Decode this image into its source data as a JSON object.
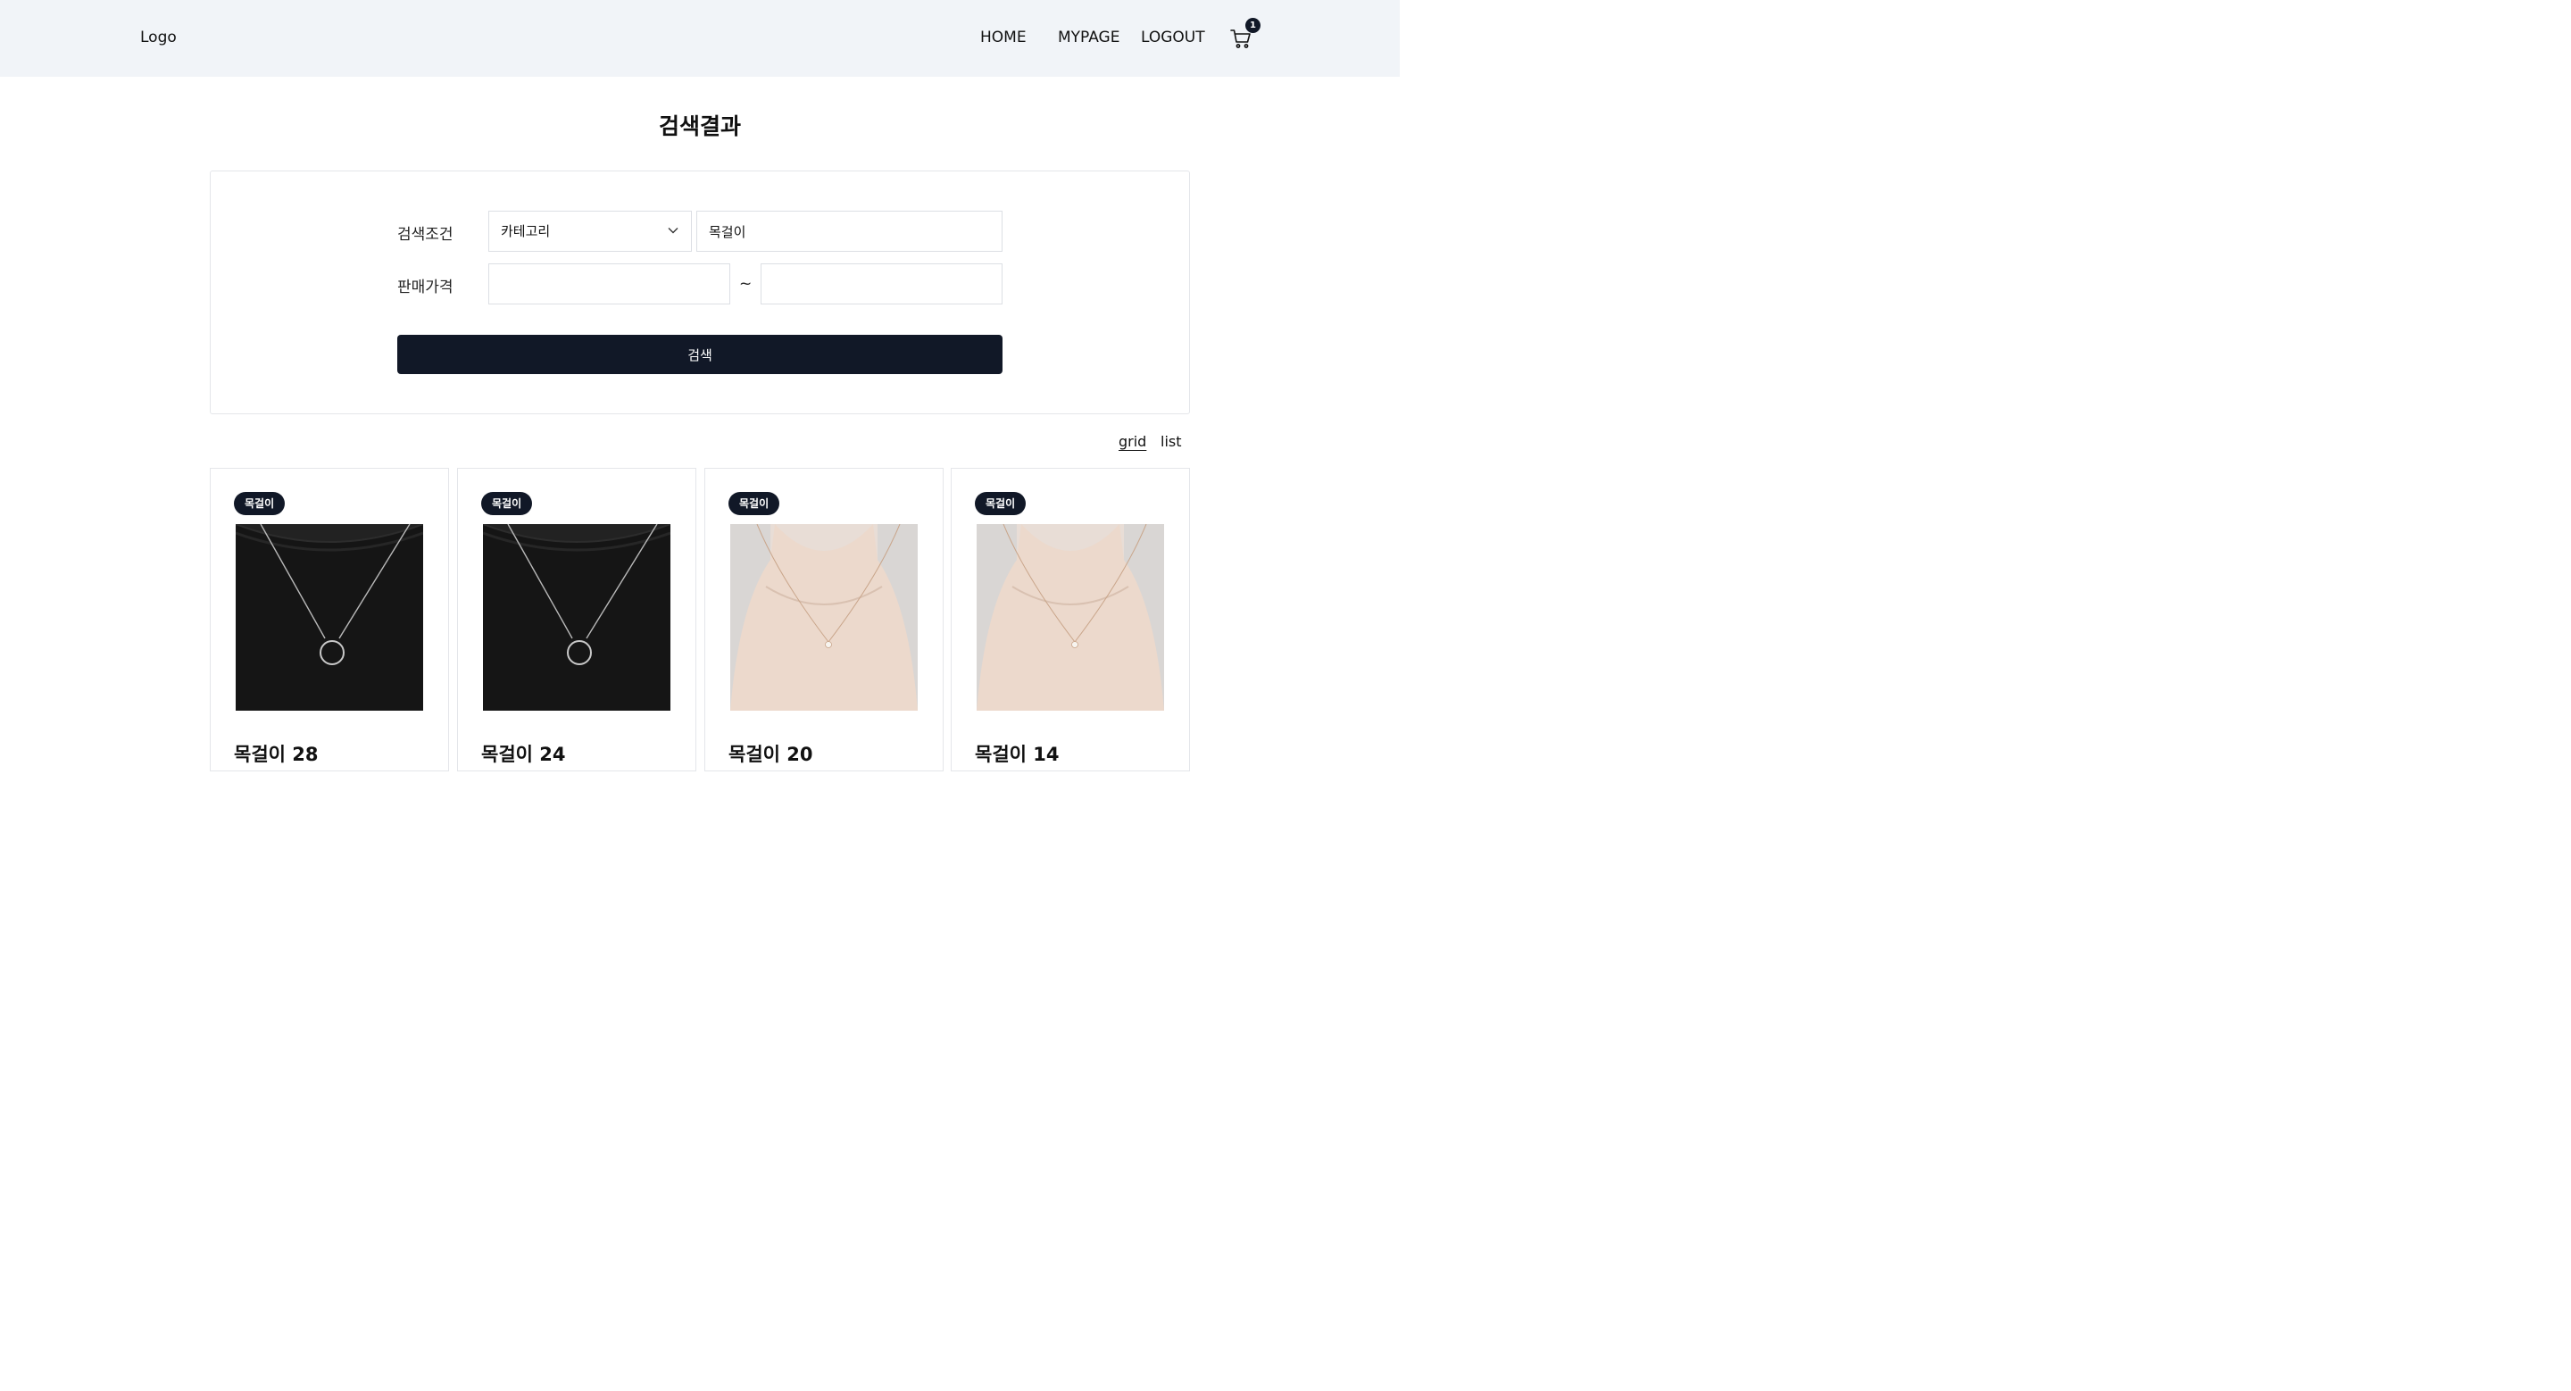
{
  "header": {
    "logo": "Logo",
    "nav": [
      "HOME",
      "MYPAGE",
      "LOGOUT"
    ],
    "cart_icon": "cart-icon",
    "cart_count": "1"
  },
  "page": {
    "title": "검색결과"
  },
  "search": {
    "condition_label": "검색조건",
    "condition_select": "카테고리",
    "condition_value": "목걸이",
    "price_label": "판매가격",
    "price_min": "",
    "price_max": "",
    "range_separator": "~",
    "button": "검색"
  },
  "view": {
    "options": [
      "grid",
      "list"
    ],
    "active": "grid"
  },
  "products": [
    {
      "category": "목걸이",
      "name": "목걸이 28",
      "image": "black-shirt-ring-necklace"
    },
    {
      "category": "목걸이",
      "name": "목걸이 24",
      "image": "black-shirt-ring-necklace"
    },
    {
      "category": "목걸이",
      "name": "목걸이 20",
      "image": "gold-pendant-necklace"
    },
    {
      "category": "목걸이",
      "name": "목걸이 14",
      "image": "gold-pendant-necklace"
    }
  ],
  "colors": {
    "header_bg": "#f1f4f8",
    "primary": "#111827",
    "border": "#e4e6ea"
  }
}
